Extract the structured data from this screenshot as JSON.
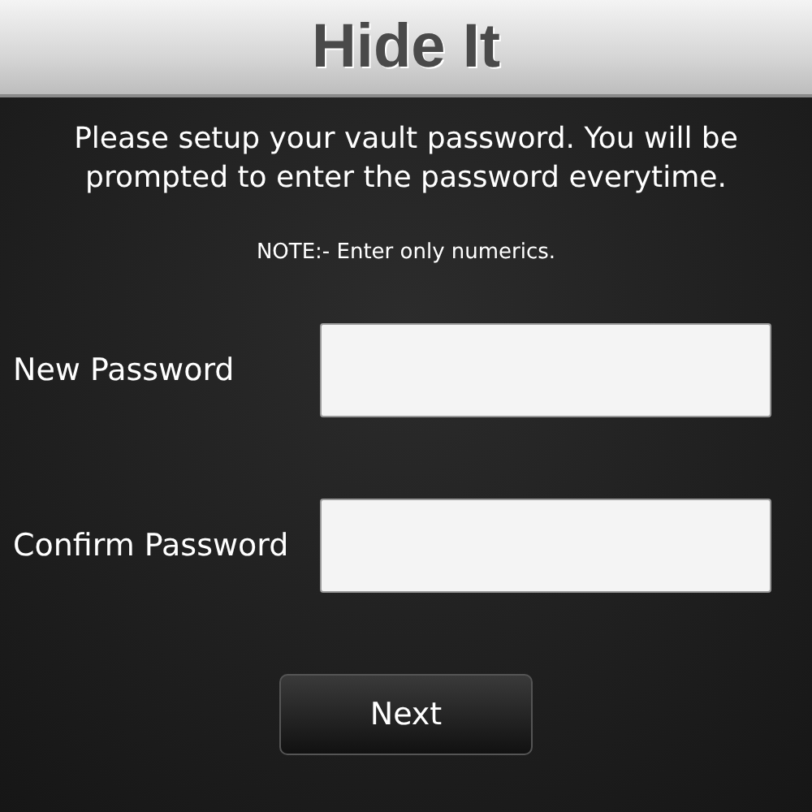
{
  "header": {
    "title": "Hide It"
  },
  "instructions": "Please setup your vault password. You will be prompted to enter the password everytime.",
  "note": "NOTE:- Enter only numerics.",
  "fields": [
    {
      "label": "New Password"
    },
    {
      "label": "Confirm Password"
    }
  ],
  "button": "Next"
}
